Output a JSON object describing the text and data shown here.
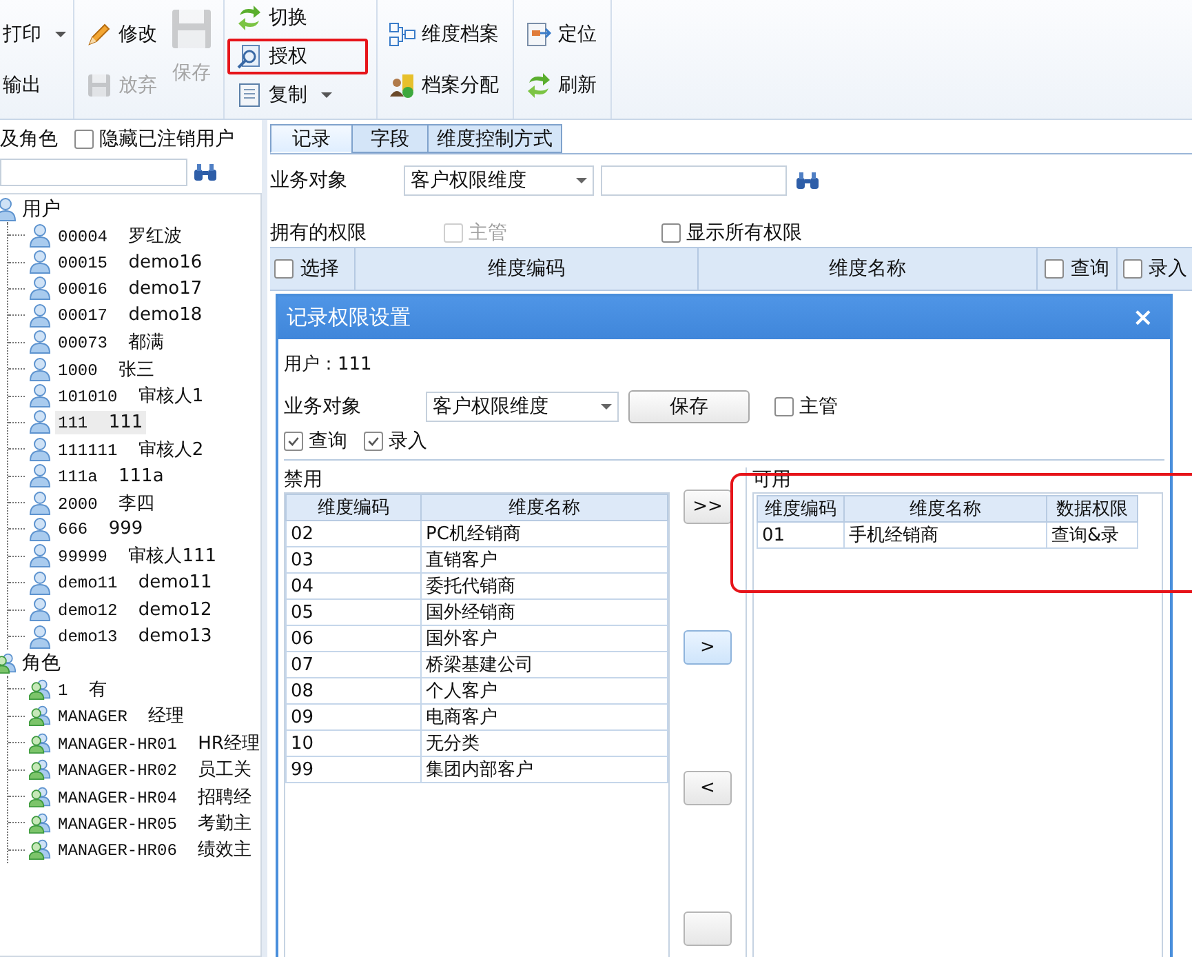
{
  "toolbar": {
    "groups": [
      {
        "buttons": [
          {
            "label": "打印",
            "kind": "small",
            "disabled": false,
            "dropdown": true,
            "highlighted": false
          },
          {
            "label": "输出",
            "kind": "small",
            "disabled": false,
            "dropdown": false,
            "highlighted": false
          }
        ]
      },
      {
        "buttons": [
          {
            "label": "修改",
            "kind": "small",
            "disabled": false,
            "dropdown": false,
            "highlighted": false
          },
          {
            "label": "放弃",
            "kind": "small",
            "disabled": true,
            "dropdown": false,
            "highlighted": false
          },
          {
            "label": "保存",
            "kind": "large",
            "disabled": true,
            "dropdown": false,
            "highlighted": false
          }
        ]
      },
      {
        "buttons": [
          {
            "label": "切换",
            "kind": "small",
            "disabled": false,
            "dropdown": false,
            "highlighted": false
          },
          {
            "label": "授权",
            "kind": "small",
            "disabled": false,
            "dropdown": false,
            "highlighted": true
          },
          {
            "label": "复制",
            "kind": "small",
            "disabled": false,
            "dropdown": true,
            "highlighted": false
          }
        ]
      },
      {
        "buttons": [
          {
            "label": "维度档案",
            "kind": "small",
            "disabled": false,
            "dropdown": false,
            "highlighted": false
          },
          {
            "label": "档案分配",
            "kind": "small",
            "disabled": false,
            "dropdown": false,
            "highlighted": false
          }
        ]
      },
      {
        "buttons": [
          {
            "label": "定位",
            "kind": "small",
            "disabled": false,
            "dropdown": false,
            "highlighted": false
          },
          {
            "label": "刷新",
            "kind": "small",
            "disabled": false,
            "dropdown": false,
            "highlighted": false
          }
        ]
      }
    ]
  },
  "sidebar": {
    "title": "及角色",
    "hide_cancelled": {
      "label": "隐藏已注销用户",
      "checked": false
    },
    "tree": [
      {
        "label": "用户",
        "kind": "users",
        "children": [
          {
            "code": "00004",
            "name": "罗红波",
            "selected": false
          },
          {
            "code": "00015",
            "name": "demo16",
            "selected": false
          },
          {
            "code": "00016",
            "name": "demo17",
            "selected": false
          },
          {
            "code": "00017",
            "name": "demo18",
            "selected": false
          },
          {
            "code": "00073",
            "name": "都满",
            "selected": false
          },
          {
            "code": "1000",
            "name": "张三",
            "selected": false
          },
          {
            "code": "101010",
            "name": "审核人1",
            "selected": false
          },
          {
            "code": "111",
            "name": "111",
            "selected": true
          },
          {
            "code": "111111",
            "name": "审核人2",
            "selected": false
          },
          {
            "code": "111a",
            "name": "111a",
            "selected": false
          },
          {
            "code": "2000",
            "name": "李四",
            "selected": false
          },
          {
            "code": "666",
            "name": "999",
            "selected": false
          },
          {
            "code": "99999",
            "name": "审核人111",
            "selected": false
          },
          {
            "code": "demo11",
            "name": "demo11",
            "selected": false
          },
          {
            "code": "demo12",
            "name": "demo12",
            "selected": false
          },
          {
            "code": "demo13",
            "name": "demo13",
            "selected": false
          }
        ]
      },
      {
        "label": "角色",
        "kind": "roles",
        "children": [
          {
            "code": "1",
            "name": "有",
            "selected": false
          },
          {
            "code": "MANAGER",
            "name": "经理",
            "selected": false
          },
          {
            "code": "MANAGER-HR01",
            "name": "HR经理",
            "selected": false
          },
          {
            "code": "MANAGER-HR02",
            "name": "员工关",
            "selected": false
          },
          {
            "code": "MANAGER-HR04",
            "name": "招聘经",
            "selected": false
          },
          {
            "code": "MANAGER-HR05",
            "name": "考勤主",
            "selected": false
          },
          {
            "code": "MANAGER-HR06",
            "name": "绩效主",
            "selected": false
          }
        ]
      }
    ]
  },
  "tabs": [
    {
      "label": "记录",
      "selected": true
    },
    {
      "label": "字段",
      "selected": false
    },
    {
      "label": "维度控制方式",
      "selected": false
    }
  ],
  "filter": {
    "label": "业务对象",
    "value": "客户权限维度"
  },
  "permissions_bar": {
    "label": "拥有的权限",
    "supervisor": {
      "label": "主管",
      "checked": false,
      "disabled": true
    },
    "show_all": {
      "label": "显示所有权限",
      "checked": false
    }
  },
  "grid": {
    "columns": [
      {
        "label": "选择",
        "kind": "checkbox",
        "checked": false
      },
      {
        "label": "维度编码",
        "kind": "text"
      },
      {
        "label": "维度名称",
        "kind": "text"
      },
      {
        "label": "查询",
        "kind": "checkbox",
        "checked": false
      },
      {
        "label": "录入",
        "kind": "checkbox",
        "checked": false
      }
    ]
  },
  "dialog": {
    "title": "记录权限设置",
    "close": "×",
    "user": "用户：111",
    "business_object": {
      "label": "业务对象",
      "value": "客户权限维度"
    },
    "save": "保存",
    "supervisor": {
      "label": "主管",
      "checked": false
    },
    "rights": [
      {
        "label": "查询",
        "checked": true
      },
      {
        "label": "录入",
        "checked": true
      }
    ],
    "disabled_list": {
      "title": "禁用",
      "columns": [
        "维度编码",
        "维度名称"
      ],
      "rows": [
        [
          "02",
          "PC机经销商"
        ],
        [
          "03",
          "直销客户"
        ],
        [
          "04",
          "委托代销商"
        ],
        [
          "05",
          "国外经销商"
        ],
        [
          "06",
          "国外客户"
        ],
        [
          "07",
          "桥梁基建公司"
        ],
        [
          "08",
          "个人客户"
        ],
        [
          "09",
          "电商客户"
        ],
        [
          "10",
          "无分类"
        ],
        [
          "99",
          "集团内部客户"
        ]
      ]
    },
    "transfer_buttons": [
      {
        "label": ">>",
        "selected": false
      },
      {
        "label": ">",
        "selected": true
      },
      {
        "label": "<",
        "selected": false
      }
    ],
    "available_list": {
      "title": "可用",
      "highlighted": true,
      "columns": [
        "维度编码",
        "维度名称",
        "数据权限"
      ],
      "rows": [
        [
          "01",
          "手机经销商",
          "查询&录"
        ]
      ]
    }
  }
}
